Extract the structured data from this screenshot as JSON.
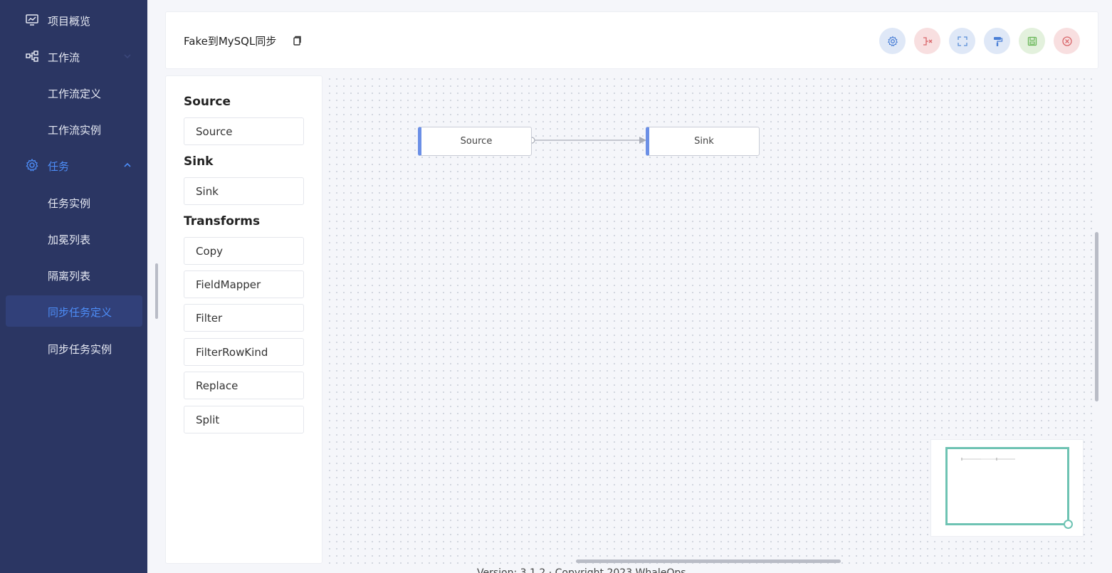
{
  "sidebar": {
    "items": [
      {
        "label": "项目概览",
        "icon": "monitor-chart-icon"
      },
      {
        "label": "工作流",
        "icon": "workflow-icon"
      },
      {
        "label": "工作流定义"
      },
      {
        "label": "工作流实例"
      },
      {
        "label": "任务",
        "icon": "gear-icon"
      },
      {
        "label": "任务实例"
      },
      {
        "label": "加冕列表"
      },
      {
        "label": "隔离列表"
      },
      {
        "label": "同步任务定义"
      },
      {
        "label": "同步任务实例"
      }
    ]
  },
  "header": {
    "title": "Fake到MySQL同步",
    "tools": [
      {
        "name": "settings",
        "icon": "gear-icon",
        "bg": "#dfe8f7",
        "fg": "#4a7fd6"
      },
      {
        "name": "delete-edge",
        "icon": "disconnect-icon",
        "bg": "#f8dfe0",
        "fg": "#d9666a"
      },
      {
        "name": "fullscreen",
        "icon": "fullscreen-icon",
        "bg": "#dfe8f7",
        "fg": "#5a8fd8"
      },
      {
        "name": "format",
        "icon": "format-brush-icon",
        "bg": "#dfe8f7",
        "fg": "#4a7fd6"
      },
      {
        "name": "save",
        "icon": "save-icon",
        "bg": "#e3f1dd",
        "fg": "#6bb85a"
      },
      {
        "name": "close",
        "icon": "close-circle-icon",
        "bg": "#f8dfe0",
        "fg": "#d9666a"
      }
    ]
  },
  "palette": {
    "categories": [
      {
        "title": "Source",
        "items": [
          "Source"
        ]
      },
      {
        "title": "Sink",
        "items": [
          "Sink"
        ]
      },
      {
        "title": "Transforms",
        "items": [
          "Copy",
          "FieldMapper",
          "Filter",
          "FilterRowKind",
          "Replace",
          "Split"
        ]
      }
    ]
  },
  "canvas": {
    "nodes": [
      {
        "label": "Source"
      },
      {
        "label": "Sink"
      }
    ]
  },
  "footer": {
    "text": "Version: 3.1.2 · Copyright 2023 WhaleOps"
  }
}
